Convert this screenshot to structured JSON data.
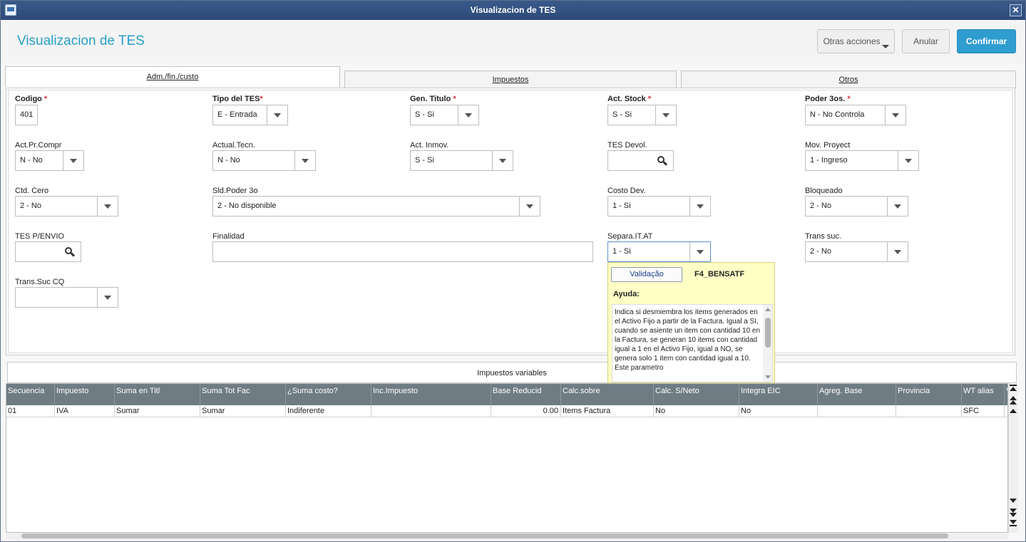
{
  "window": {
    "title": "Visualizacion de TES",
    "close_glyph": "✕"
  },
  "header": {
    "title": "Visualizacion de TES",
    "buttons": {
      "otras": "Otras acciones",
      "anular": "Anular",
      "confirmar": "Confirmar"
    }
  },
  "tabs": [
    {
      "label": "Adm./fin./custo",
      "active": true
    },
    {
      "label": "Impuestos",
      "active": false
    },
    {
      "label": "Otros",
      "active": false
    }
  ],
  "form": {
    "codigo": {
      "label": "Codigo",
      "required": true,
      "value": "401"
    },
    "tipo_tes": {
      "label": "Tipo del TES",
      "required": true,
      "value": "E - Entrada"
    },
    "gen_titulo": {
      "label": "Gen. Titulo",
      "required": true,
      "value": "S - Si"
    },
    "act_stock": {
      "label": "Act. Stock",
      "required": true,
      "value": "S - Si"
    },
    "poder_3os": {
      "label": "Poder 3os.",
      "required": true,
      "value": "N - No Controla"
    },
    "act_pr_compr": {
      "label": "Act.Pr.Compr",
      "value": "N - No"
    },
    "actual_tecn": {
      "label": "Actual.Tecn.",
      "value": "N - No"
    },
    "act_inmov": {
      "label": "Act. Inmov.",
      "value": "S - Si"
    },
    "tes_devol": {
      "label": "TES Devol.",
      "value": ""
    },
    "mov_proyect": {
      "label": "Mov. Proyect",
      "value": "1 - Ingreso"
    },
    "ctd_cero": {
      "label": "Ctd. Cero",
      "value": "2 - No"
    },
    "sld_poder_3o": {
      "label": "Sld.Poder 3o",
      "value": "2 - No disponible"
    },
    "costo_dev": {
      "label": "Costo Dev.",
      "value": "1 - Si"
    },
    "bloqueado": {
      "label": "Bloqueado",
      "value": "2 - No"
    },
    "tes_penvio": {
      "label": "TES P/ENVIO",
      "value": ""
    },
    "finalidad": {
      "label": "Finalidad",
      "value": ""
    },
    "separa_it_at": {
      "label": "Separa.IT.AT",
      "value": "1 - Si"
    },
    "trans_suc": {
      "label": "Trans suc.",
      "value": "2 - No"
    },
    "trans_suc_cq": {
      "label": "Trans.Suc CQ",
      "value": ""
    }
  },
  "help_popup": {
    "button": "Validação",
    "code": "F4_BENSATF",
    "heading": "Ayuda:",
    "text": "Indica si desmiembra los items generados en el Activo Fijo a partir de la Factura. Igual a SI, cuando se asiente un item con cantidad 10 en la Factura, se generan 10 items con cantidad igual a 1 en el Activo Fijo, igual a NO, se genera solo 1 item con cantidad igual a 10. Este parametro"
  },
  "grid": {
    "title": "Impuestos variables",
    "columns": [
      "Secuencia",
      "Impuesto",
      "Suma en Titl",
      "Suma Tot Fac",
      "¿Suma costo?",
      "Inc.Impuesto",
      "Base Reducid",
      "Calc.sobre",
      "Calc. S/Neto",
      "Integra EIC",
      "Agreg. Base",
      "Provincia",
      "WT alias",
      "V"
    ],
    "rows": [
      [
        "01",
        "IVA",
        "Sumar",
        "Sumar",
        "Indiferente",
        "",
        "0.00",
        "Items Factura",
        "No",
        "No",
        "",
        "",
        "SFC",
        ""
      ]
    ]
  }
}
